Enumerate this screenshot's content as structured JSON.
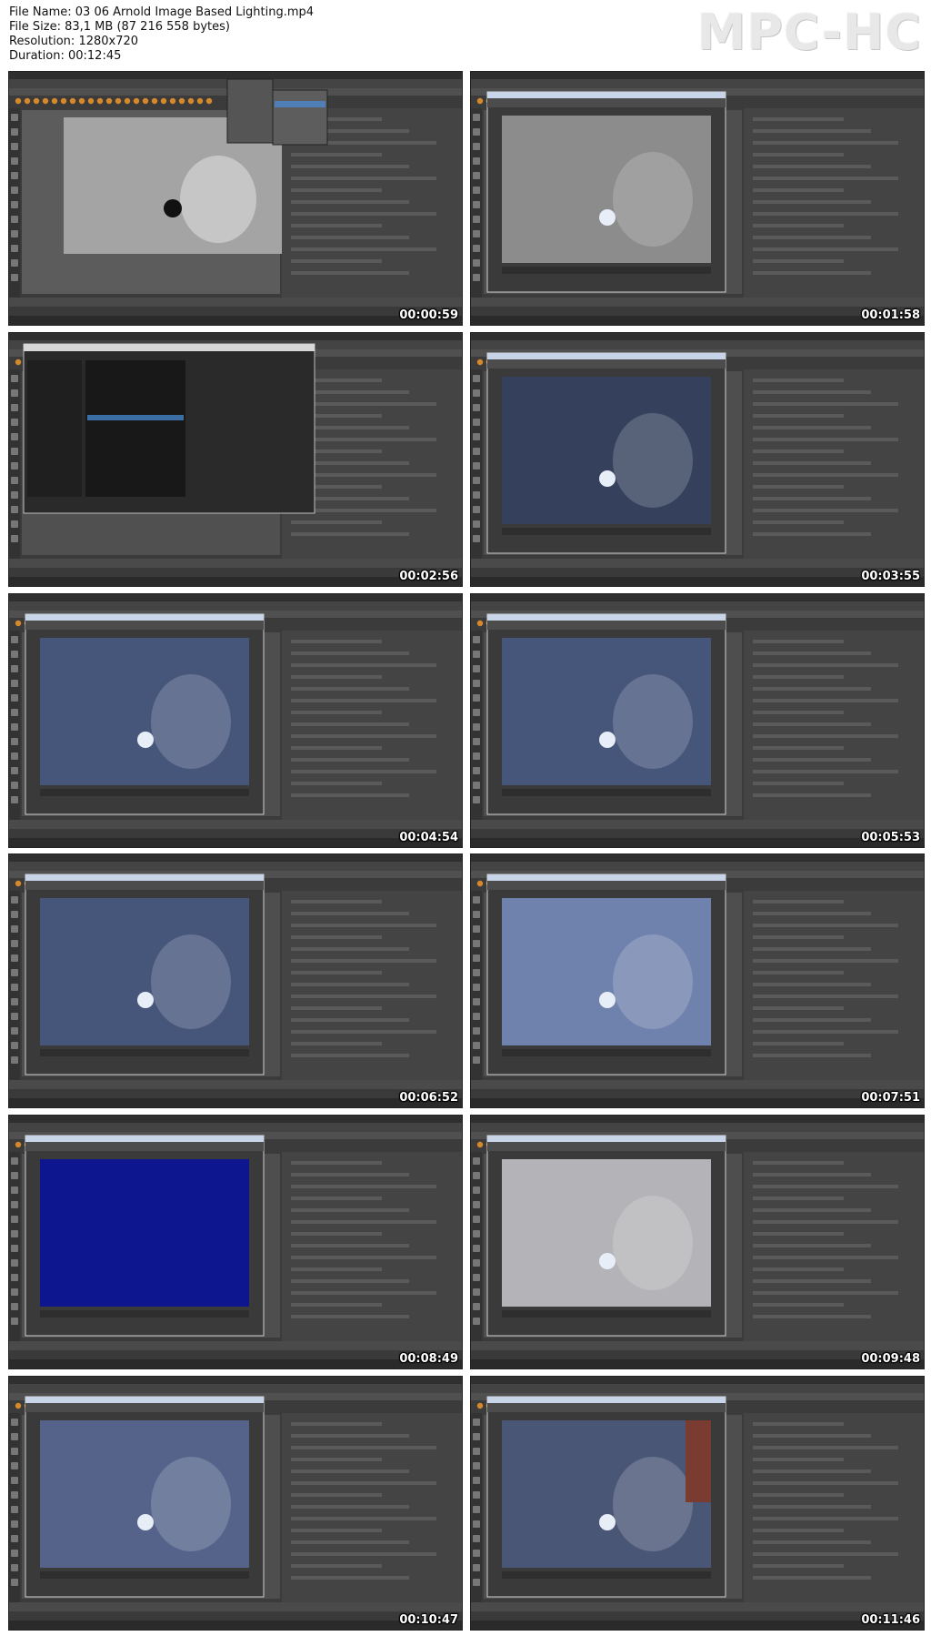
{
  "file_info": {
    "name_label": "File Name:",
    "name": "03 06 Arnold Image Based Lighting.mp4",
    "size_label": "File Size:",
    "size": "83,1 MB (87 216 558 bytes)",
    "resolution_label": "Resolution:",
    "resolution": "1280x720",
    "duration_label": "Duration:",
    "duration": "00:12:45"
  },
  "logo": "MPC-HC",
  "colors": {
    "maya_bg": "#3b3b3b",
    "toolbar_icon": "#d6892a",
    "viewport_blue_night": "#3a4868",
    "render_blue_deep": "#0d168e",
    "viewport_grey": "#9a9a9a"
  },
  "thumbnails": [
    {
      "timestamp": "00:00:59",
      "scene": "viewport-grey",
      "window": "none",
      "menu_open": true
    },
    {
      "timestamp": "00:01:58",
      "scene": "render-grey",
      "window": "render-view",
      "menu_open": false
    },
    {
      "timestamp": "00:02:56",
      "scene": "file-browser",
      "window": "open-dialog",
      "menu_open": false
    },
    {
      "timestamp": "00:03:55",
      "scene": "render-blue-dark",
      "window": "render-view",
      "menu_open": false
    },
    {
      "timestamp": "00:04:54",
      "scene": "render-blue",
      "window": "render-view",
      "menu_open": false
    },
    {
      "timestamp": "00:05:53",
      "scene": "render-blue",
      "window": "render-view",
      "menu_open": false
    },
    {
      "timestamp": "00:06:52",
      "scene": "render-blue",
      "window": "render-view",
      "menu_open": false
    },
    {
      "timestamp": "00:07:51",
      "scene": "render-blue-bright",
      "window": "render-view",
      "menu_open": false
    },
    {
      "timestamp": "00:08:49",
      "scene": "render-deep-blue",
      "window": "render-view",
      "menu_open": false
    },
    {
      "timestamp": "00:09:48",
      "scene": "render-grey-bright",
      "window": "render-view",
      "menu_open": false
    },
    {
      "timestamp": "00:10:47",
      "scene": "render-blue-noisy",
      "window": "render-view",
      "menu_open": false
    },
    {
      "timestamp": "00:11:46",
      "scene": "render-blue-red",
      "window": "render-view",
      "menu_open": false
    }
  ]
}
